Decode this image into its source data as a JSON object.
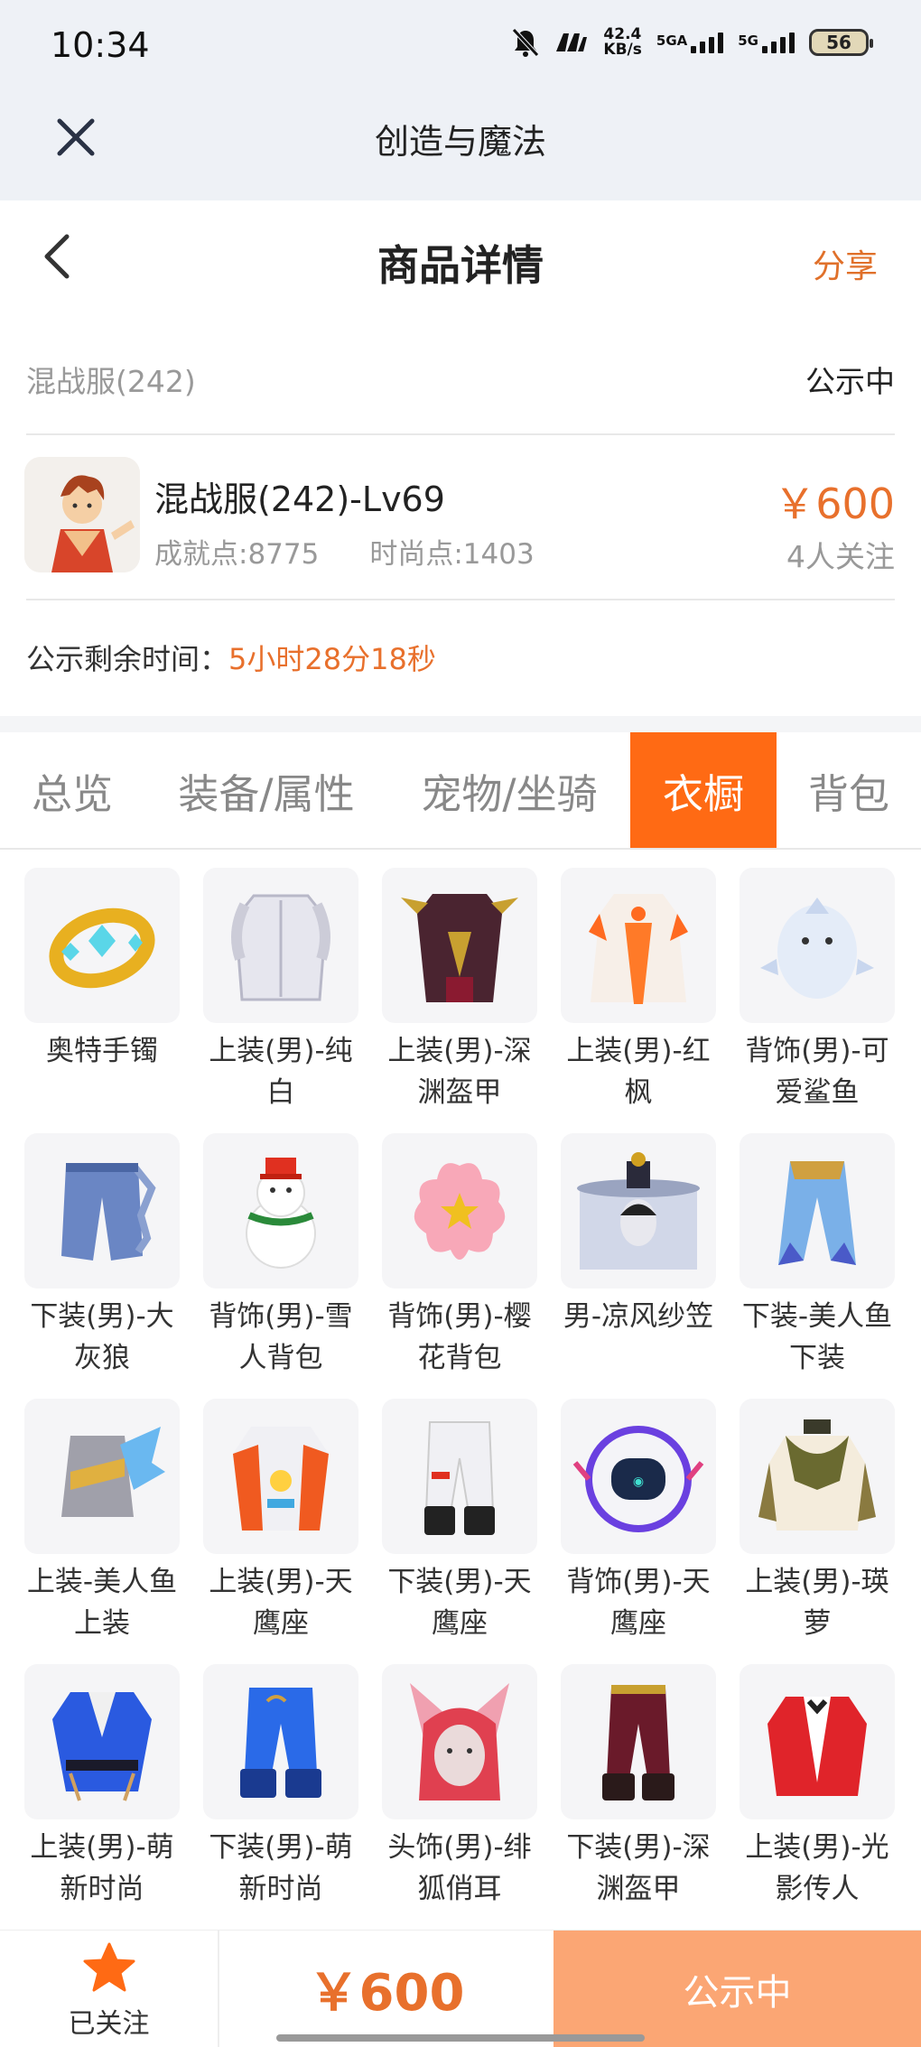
{
  "status_bar": {
    "time": "10:34",
    "net_speed": "42.4",
    "net_unit": "KB/s",
    "sig1": "5GA",
    "sig2": "5G",
    "battery": "56"
  },
  "app": {
    "title": "创造与魔法"
  },
  "page": {
    "title": "商品详情",
    "share": "分享"
  },
  "server": {
    "name": "混战服(242)",
    "status": "公示中"
  },
  "product": {
    "name": "混战服(242)-Lv69",
    "achievement": "成就点:8775",
    "fashion": "时尚点:1403",
    "price": "￥600",
    "watchers": "4人关注"
  },
  "remaining": {
    "label": "公示剩余时间：",
    "value": "5小时28分18秒"
  },
  "tabs": [
    "总览",
    "装备/属性",
    "宠物/坐骑",
    "衣橱",
    "背包"
  ],
  "active_tab": "衣橱",
  "items": [
    {
      "name": "奥特手镯",
      "icon": "bracelet-icon"
    },
    {
      "name": "上装(男)-纯白",
      "icon": "white-coat-icon"
    },
    {
      "name": "上装(男)-深渊盔甲",
      "icon": "abyss-armor-icon"
    },
    {
      "name": "上装(男)-红枫",
      "icon": "red-maple-robe-icon"
    },
    {
      "name": "背饰(男)-可爱鲨鱼",
      "icon": "shark-backpack-icon"
    },
    {
      "name": "下装(男)-大灰狼",
      "icon": "wolf-pants-icon"
    },
    {
      "name": "背饰(男)-雪人背包",
      "icon": "snowman-backpack-icon"
    },
    {
      "name": "背饰(男)-樱花背包",
      "icon": "sakura-backpack-icon"
    },
    {
      "name": "男-凉风纱笠",
      "icon": "veil-hat-icon"
    },
    {
      "name": "下装-美人鱼下装",
      "icon": "mermaid-skirt-icon"
    },
    {
      "name": "上装-美人鱼上装",
      "icon": "mermaid-top-icon"
    },
    {
      "name": "上装(男)-天鹰座",
      "icon": "aquila-jacket-icon"
    },
    {
      "name": "下装(男)-天鹰座",
      "icon": "aquila-pants-icon"
    },
    {
      "name": "背饰(男)-天鹰座",
      "icon": "aquila-backpack-icon"
    },
    {
      "name": "上装(男)-瑛萝",
      "icon": "scarf-jacket-icon"
    },
    {
      "name": "上装(男)-萌新时尚",
      "icon": "blue-robe-icon"
    },
    {
      "name": "下装(男)-萌新时尚",
      "icon": "blue-pants-icon"
    },
    {
      "name": "头饰(男)-绯狐俏耳",
      "icon": "fox-ears-icon"
    },
    {
      "name": "下装(男)-深渊盔甲",
      "icon": "abyss-pants-icon"
    },
    {
      "name": "上装(男)-光影传人",
      "icon": "red-jacket-icon"
    }
  ],
  "bottom": {
    "follow_label": "已关注",
    "price": "￥600",
    "status": "公示中"
  },
  "colors": {
    "accent": "#ff6a14",
    "price": "#e8702c",
    "status_button": "#fba674"
  }
}
